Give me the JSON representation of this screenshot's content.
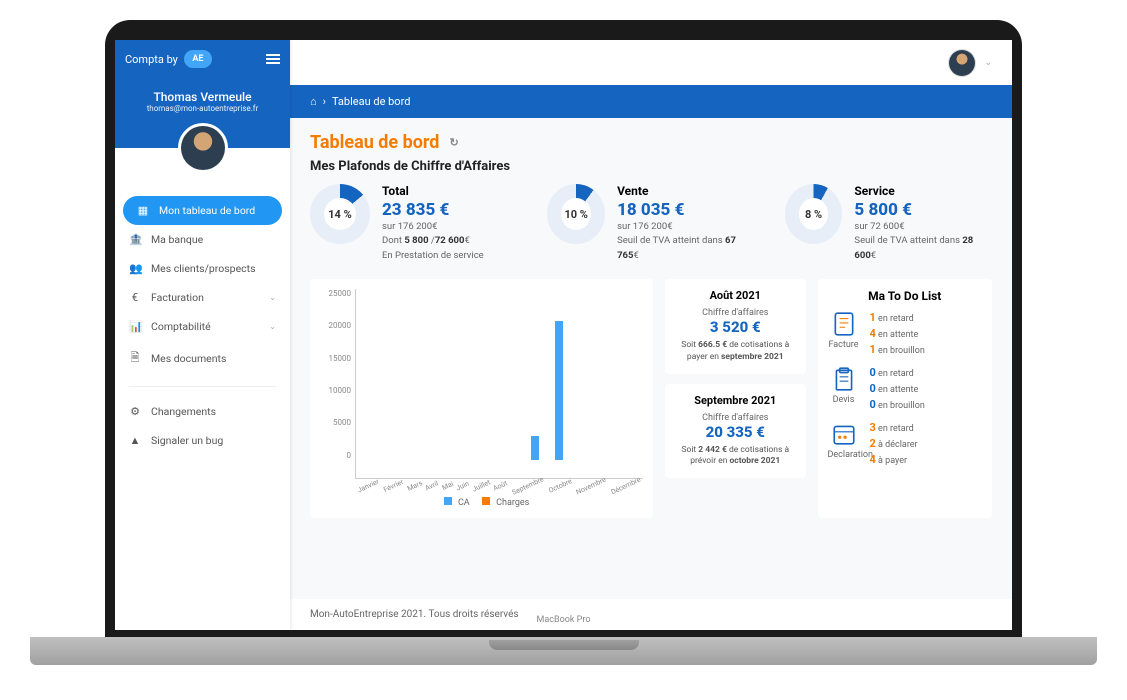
{
  "brand": {
    "prefix": "Compta by",
    "logo_text": "AE"
  },
  "user": {
    "name": "Thomas Vermeule",
    "email": "thomas@mon-autoentreprise.fr"
  },
  "sidebar": {
    "items": [
      {
        "label": "Mon tableau de bord",
        "icon": "▦"
      },
      {
        "label": "Ma banque",
        "icon": "🏦"
      },
      {
        "label": "Mes clients/prospects",
        "icon": "👥"
      },
      {
        "label": "Facturation",
        "icon": "€",
        "chevron": true
      },
      {
        "label": "Comptabilité",
        "icon": "📊",
        "chevron": true
      },
      {
        "label": "Mes documents",
        "icon": "🗎"
      }
    ],
    "secondary": [
      {
        "label": "Changements",
        "icon": "⚙"
      },
      {
        "label": "Signaler un bug",
        "icon": "▲"
      }
    ]
  },
  "breadcrumb": {
    "home": "⌂",
    "sep": "›",
    "current": "Tableau de bord"
  },
  "page": {
    "title": "Tableau de bord",
    "section": "Mes Plafonds de Chiffre d'Affaires"
  },
  "plafonds": [
    {
      "title": "Total",
      "pct": "14 %",
      "pct_num": 14,
      "amount": "23 835 €",
      "line1": "sur 176 200€",
      "line2": "Dont 5 800 /72 600€",
      "line3": "En Prestation de service"
    },
    {
      "title": "Vente",
      "pct": "10 %",
      "pct_num": 10,
      "amount": "18 035 €",
      "line1": "sur 176 200€",
      "line2": "Seuil de TVA atteint dans 67 765€",
      "line3": ""
    },
    {
      "title": "Service",
      "pct": "8 %",
      "pct_num": 8,
      "amount": "5 800 €",
      "line1": "sur 72 600€",
      "line2": "Seuil de TVA atteint dans 28 600€",
      "line3": ""
    }
  ],
  "chart_data": {
    "type": "bar",
    "categories": [
      "Janvier",
      "Février",
      "Mars",
      "Avril",
      "Mai",
      "Juin",
      "Juillet",
      "Août",
      "Septembre",
      "Octobre",
      "Novembre",
      "Décembre"
    ],
    "series": [
      {
        "name": "CA",
        "values": [
          0,
          0,
          0,
          0,
          0,
          0,
          0,
          3520,
          20335,
          0,
          0,
          0
        ],
        "color": "#42a5f5"
      },
      {
        "name": "Charges",
        "values": [
          0,
          0,
          0,
          0,
          0,
          0,
          0,
          0,
          0,
          0,
          0,
          0
        ],
        "color": "#f57c00"
      }
    ],
    "ylim": [
      0,
      25000
    ],
    "yticks": [
      25000,
      20000,
      15000,
      10000,
      5000,
      0
    ]
  },
  "months": [
    {
      "title": "Août 2021",
      "label": "Chiffre d'affaires",
      "amount": "3 520 €",
      "detail": "Soit 666.5 € de cotisations à payer en septembre 2021"
    },
    {
      "title": "Septembre 2021",
      "label": "Chiffre d'affaires",
      "amount": "20 335 €",
      "detail": "Soit 2 442 € de cotisations à prévoir en octobre 2021"
    }
  ],
  "todo": {
    "title": "Ma To Do List",
    "groups": [
      {
        "name": "Facture",
        "color": "#f57c00",
        "lines": [
          {
            "n": "1",
            "t": "en retard"
          },
          {
            "n": "4",
            "t": "en attente"
          },
          {
            "n": "1",
            "t": "en brouillon"
          }
        ]
      },
      {
        "name": "Devis",
        "color": "#1565c0",
        "lines": [
          {
            "n": "0",
            "t": "en retard"
          },
          {
            "n": "0",
            "t": "en attente"
          },
          {
            "n": "0",
            "t": "en brouillon"
          }
        ]
      },
      {
        "name": "Declaration",
        "color": "#f57c00",
        "lines": [
          {
            "n": "3",
            "t": "en retard"
          },
          {
            "n": "2",
            "t": "à déclarer"
          },
          {
            "n": "4",
            "t": "à payer"
          }
        ]
      }
    ]
  },
  "footer": "Mon-AutoEntreprise 2021. Tous droits réservés"
}
